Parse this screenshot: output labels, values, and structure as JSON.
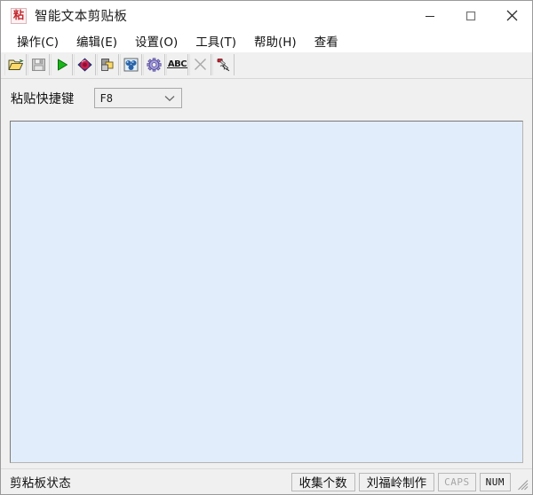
{
  "window": {
    "title": "智能文本剪贴板",
    "icon": "clipboard-paste-icon",
    "controls": {
      "minimize": "minimize-icon",
      "maximize": "maximize-icon",
      "close": "close-icon"
    }
  },
  "menubar": {
    "items": [
      {
        "label": "操作(C)",
        "name": "menu-operation"
      },
      {
        "label": "编辑(E)",
        "name": "menu-edit"
      },
      {
        "label": "设置(O)",
        "name": "menu-settings"
      },
      {
        "label": "工具(T)",
        "name": "menu-tools"
      },
      {
        "label": "帮助(H)",
        "name": "menu-help"
      },
      {
        "label": "查看",
        "name": "menu-view"
      }
    ]
  },
  "toolbar": {
    "buttons": [
      {
        "icon": "open-folder-icon",
        "enabled": true
      },
      {
        "icon": "save-disk-icon",
        "enabled": false
      },
      {
        "icon": "play-start-icon",
        "enabled": true
      },
      {
        "icon": "diamond-gem-icon",
        "enabled": true
      },
      {
        "icon": "copy-layers-icon",
        "enabled": true
      },
      {
        "icon": "picture-image-icon",
        "enabled": true
      },
      {
        "icon": "gear-settings-icon",
        "enabled": true
      },
      {
        "icon": "abc-spellcheck-icon",
        "enabled": true
      },
      {
        "icon": "close-x-icon",
        "enabled": false
      },
      {
        "icon": "hand-marker-icon",
        "enabled": true
      }
    ]
  },
  "shortcut": {
    "label": "粘贴快捷键",
    "value": "F8",
    "options": [
      "F8"
    ]
  },
  "content": {
    "background_color": "#e2edfb",
    "text": ""
  },
  "statusbar": {
    "main_text": "剪粘板状态",
    "panels": [
      {
        "label": "收集个数",
        "name": "status-count-panel",
        "dim": false,
        "mono": false
      },
      {
        "label": "刘福岭制作",
        "name": "status-author-panel",
        "dim": false,
        "mono": false
      },
      {
        "label": "CAPS",
        "name": "status-caps-panel",
        "dim": true,
        "mono": true
      },
      {
        "label": "NUM",
        "name": "status-num-panel",
        "dim": false,
        "mono": true
      }
    ],
    "grip": "resize-grip-icon"
  }
}
